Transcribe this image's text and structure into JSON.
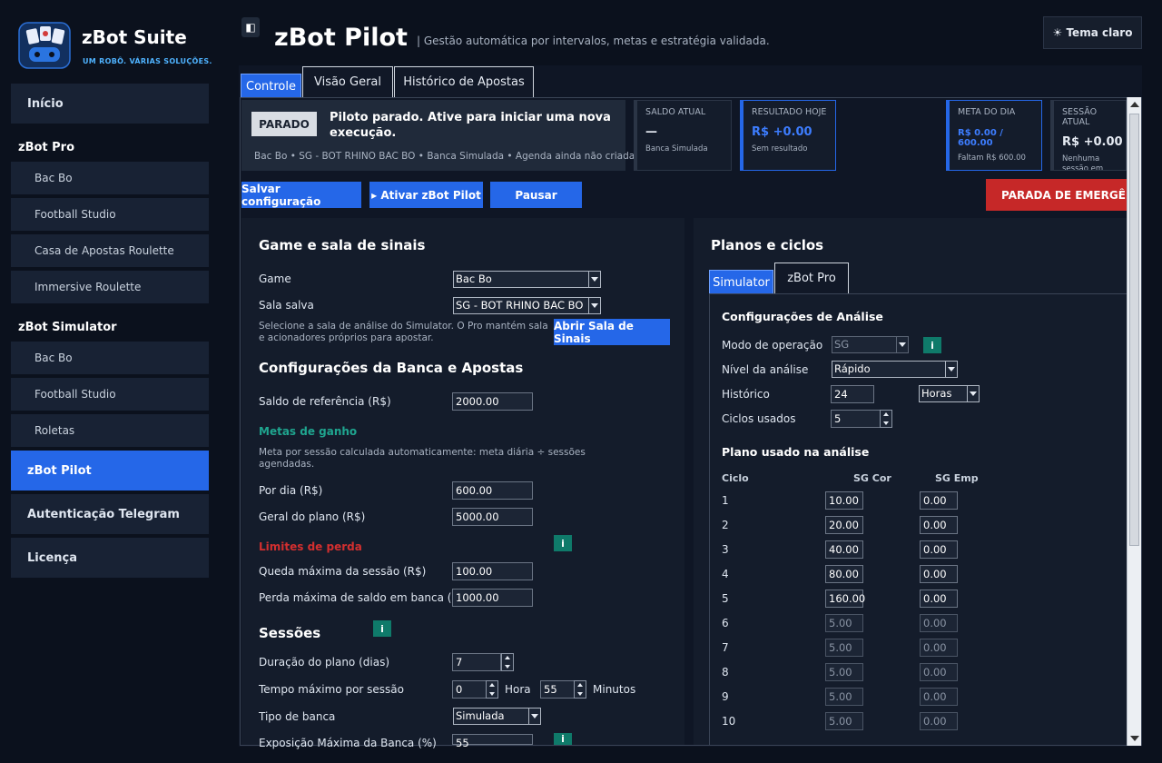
{
  "sidebar": {
    "brand": "zBot Suite",
    "tagline": "UM ROBÔ. VÁRIAS SOLUÇÕES.",
    "inicio": "Início",
    "pro_title": "zBot Pro",
    "pro_items": [
      "Bac Bo",
      "Football Studio",
      "Casa de Apostas Roulette",
      "Immersive Roulette"
    ],
    "sim_title": "zBot Simulator",
    "sim_items": [
      "Bac Bo",
      "Football Studio",
      "Roletas"
    ],
    "pilot": "zBot Pilot",
    "telegram": "Autenticação Telegram",
    "license": "Licença"
  },
  "header": {
    "title": "zBot Pilot",
    "subtitle": "| Gestão automática por intervalos, metas e estratégia validada.",
    "theme_button": "☀ Tema claro"
  },
  "tabs": [
    "Controle",
    "Visão Geral",
    "Histórico de Apostas"
  ],
  "status": {
    "badge": "PARADO",
    "message": "Piloto parado. Ative para iniciar uma nova execução.",
    "footer": "Bac Bo • SG - BOT RHINO BAC BO • Banca Simulada • Agenda ainda não criada"
  },
  "kpis": [
    {
      "title": "SALDO ATUAL",
      "value": "—",
      "sub": "Banca Simulada"
    },
    {
      "title": "RESULTADO HOJE",
      "value": "R$ +0.00",
      "sub": "Sem resultado"
    },
    {
      "title": "META DO DIA",
      "value": "R$ 0.00 / 600.00",
      "sub": "Faltam R$ 600.00"
    },
    {
      "title": "SESSÃO ATUAL",
      "value": "R$ +0.00",
      "sub": "Nenhuma sessão em execução"
    }
  ],
  "actions": {
    "save": "Salvar configuração",
    "activate": "▸ Ativar zBot Pilot",
    "pause": "Pausar",
    "emergency": "PARADA DE EMERGÊNCIA"
  },
  "left": {
    "game_title": "Game e sala de sinais",
    "game_label": "Game",
    "game_value": "Bac Bo",
    "room_label": "Sala salva",
    "room_value": "SG - BOT RHINO BAC BO",
    "room_note": "Selecione a sala de análise do Simulator. O Pro mantém sala e acionadores próprios para apostar.",
    "open_room": "Abrir Sala de Sinais",
    "bank_title": "Configurações da Banca e Apostas",
    "ref_label": "Saldo de referência (R$)",
    "ref_value": "2000.00",
    "goals_title": "Metas de ganho",
    "goals_note": "Meta por sessão calculada automaticamente: meta diária ÷ sessões agendadas.",
    "per_day_label": "Por dia (R$)",
    "per_day_value": "600.00",
    "plan_label": "Geral do plano (R$)",
    "plan_value": "5000.00",
    "loss_title": "Limites de perda",
    "session_loss_label": "Queda máxima da sessão (R$)",
    "session_loss_value": "100.00",
    "bank_loss_label": "Perda máxima de saldo em banca (R$)",
    "bank_loss_value": "1000.00",
    "sessions_title": "Sessões",
    "duration_label": "Duração do plano (dias)",
    "duration_value": "7",
    "max_time_label": "Tempo máximo por sessão",
    "hours_value": "0",
    "hours_unit": "Hora",
    "minutes_value": "55",
    "minutes_unit": "Minutos",
    "bank_type_label": "Tipo de banca",
    "bank_type_value": "Simulada",
    "exposure_label": "Exposição Máxima da Banca (%)",
    "exposure_value": "55",
    "info": "i"
  },
  "right": {
    "title": "Planos e ciclos",
    "tabs": [
      "Simulator",
      "zBot Pro"
    ],
    "analysis_title": "Configurações de Análise",
    "mode_label": "Modo de operação",
    "mode_value": "SG",
    "level_label": "Nível da análise",
    "level_value": "Rápido",
    "history_label": "Histórico",
    "history_value": "24",
    "history_unit": "Horas",
    "cycles_label": "Ciclos usados",
    "cycles_value": "5",
    "plan_title": "Plano usado na análise",
    "col_cycle": "Ciclo",
    "col_cor": "SG Cor",
    "col_emp": "SG Emp",
    "rows": [
      {
        "n": "1",
        "cor": "10.00",
        "emp": "0.00"
      },
      {
        "n": "2",
        "cor": "20.00",
        "emp": "0.00"
      },
      {
        "n": "3",
        "cor": "40.00",
        "emp": "0.00"
      },
      {
        "n": "4",
        "cor": "80.00",
        "emp": "0.00"
      },
      {
        "n": "5",
        "cor": "160.00",
        "emp": "0.00"
      },
      {
        "n": "6",
        "cor": "5.00",
        "emp": "0.00"
      },
      {
        "n": "7",
        "cor": "5.00",
        "emp": "0.00"
      },
      {
        "n": "8",
        "cor": "5.00",
        "emp": "0.00"
      },
      {
        "n": "9",
        "cor": "5.00",
        "emp": "0.00"
      },
      {
        "n": "10",
        "cor": "5.00",
        "emp": "0.00"
      }
    ]
  },
  "colors": {
    "accent": "#2567e8",
    "danger": "#c62828",
    "teal": "#0f7a6a",
    "goal_green": "#1fa58f",
    "loss_red": "#d32f2f"
  }
}
